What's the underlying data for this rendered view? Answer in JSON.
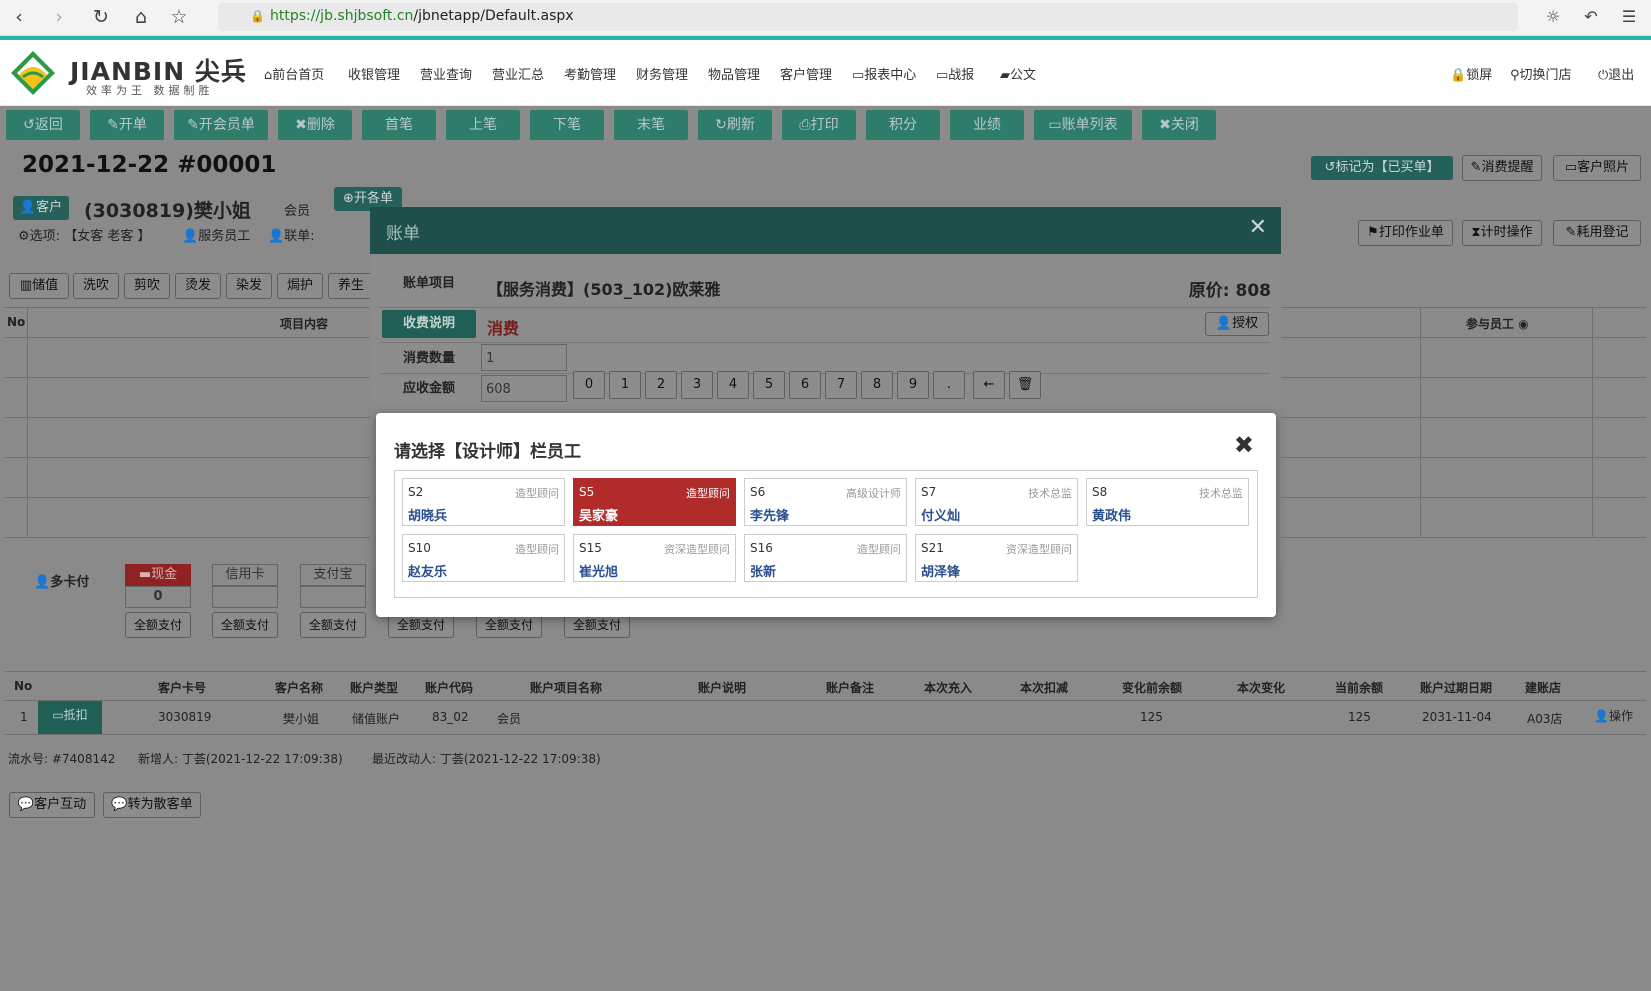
{
  "browser": {
    "url_host": "https://jb.shjbsoft.cn",
    "url_path": "/jbnetapp/Default.aspx"
  },
  "header": {
    "brand": "JIANBIN 尖兵",
    "brand_sub": "效率为王 数据制胜",
    "nav": [
      "前台首页",
      "收银管理",
      "营业查询",
      "营业汇总",
      "考勤管理",
      "财务管理",
      "物品管理",
      "客户管理",
      "报表中心",
      "战报",
      "公文"
    ],
    "right": [
      "锁屏",
      "切换门店",
      "退出"
    ]
  },
  "toolbar": [
    "返回",
    "开单",
    "开会员单",
    "删除",
    "首笔",
    "上笔",
    "下笔",
    "末笔",
    "刷新",
    "打印",
    "积分",
    "业绩",
    "账单列表",
    "关闭"
  ],
  "order": {
    "date_no": "2021-12-22  #00001",
    "customer_tag": "客户",
    "customer": "(3030819)樊小姐",
    "member": "会员",
    "open_btn": "开各单",
    "options_label": "选项:",
    "options_value": "【女客 老客 】",
    "service_staff": "服务员工",
    "link_order": "联单:",
    "right_btns": [
      "标记为【已买单】",
      "消费提醒",
      "客户照片"
    ],
    "right_btns2": [
      "打印作业单",
      "计时操作",
      "耗用登记"
    ],
    "categories": [
      "储值",
      "洗吹",
      "剪吹",
      "烫发",
      "染发",
      "焗护",
      "养生"
    ],
    "col_no": "No",
    "col_item": "项目内容",
    "col_staff": "参与员工"
  },
  "payment": {
    "multi": "多卡付",
    "methods": [
      "现金",
      "信用卡",
      "支付宝"
    ],
    "cash_value": "0",
    "full_pay": "全额支付"
  },
  "account_table": {
    "headers": [
      "No",
      "",
      "客户卡号",
      "客户名称",
      "账户类型",
      "账户代码",
      "账户项目名称",
      "账户说明",
      "账户备注",
      "本次充入",
      "本次扣减",
      "变化前余额",
      "本次变化",
      "当前余额",
      "账户过期日期",
      "建账店",
      ""
    ],
    "row": [
      "1",
      "抵扣",
      "3030819",
      "樊小姐",
      "储值账户",
      "83_02",
      "会员",
      "",
      "",
      "",
      "",
      "125",
      "",
      "125",
      "2031-11-04",
      "A03店",
      "操作"
    ]
  },
  "footer_info": {
    "serial": "流水号: #7408142",
    "created": "新增人: 丁荟(2021-12-22 17:09:38)",
    "modified": "最近改动人: 丁荟(2021-12-22 17:09:38)",
    "btns": [
      "客户互动",
      "转为散客单"
    ]
  },
  "bill": {
    "title": "账单",
    "item_label": "账单项目",
    "item_value": "【服务消费】(503_102)欧莱雅",
    "orig_price": "原价: 808",
    "fee_label": "收费说明",
    "fee_value": "消费",
    "auth": "授权",
    "qty_label": "消费数量",
    "qty_value": "1",
    "amount_label": "应收金额",
    "amount_value": "608",
    "keys": [
      "0",
      "1",
      "2",
      "3",
      "4",
      "5",
      "6",
      "7",
      "8",
      "9",
      "."
    ]
  },
  "employee_dialog": {
    "title": "请选择【设计师】栏员工",
    "employees": [
      {
        "code": "S2",
        "role": "造型顾问",
        "name": "胡晓兵",
        "selected": false
      },
      {
        "code": "S5",
        "role": "造型顾问",
        "name": "吴家豪",
        "selected": true
      },
      {
        "code": "S6",
        "role": "高级设计师",
        "name": "李先锋",
        "selected": false
      },
      {
        "code": "S7",
        "role": "技术总监",
        "name": "付义灿",
        "selected": false
      },
      {
        "code": "S8",
        "role": "技术总监",
        "name": "黄政伟",
        "selected": false
      },
      {
        "code": "S10",
        "role": "造型顾问",
        "name": "赵友乐",
        "selected": false
      },
      {
        "code": "S15",
        "role": "资深造型顾问",
        "name": "崔光旭",
        "selected": false
      },
      {
        "code": "S16",
        "role": "造型顾问",
        "name": "张新",
        "selected": false
      },
      {
        "code": "S21",
        "role": "资深造型顾问",
        "name": "胡泽锋",
        "selected": false
      }
    ]
  }
}
